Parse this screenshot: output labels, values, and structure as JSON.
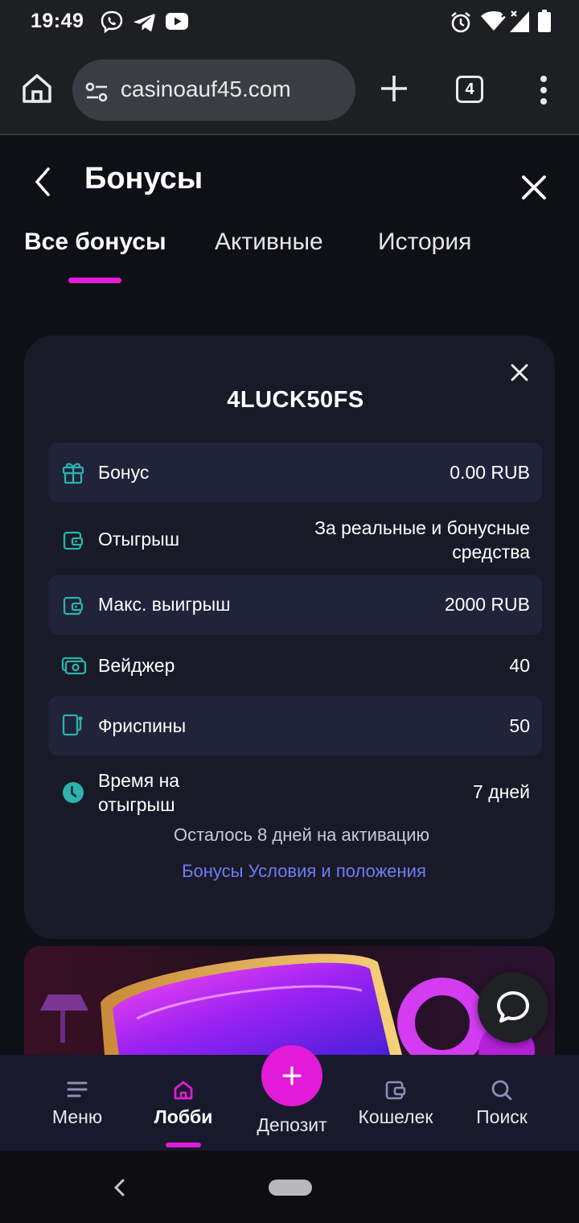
{
  "status_bar": {
    "time": "19:49",
    "left_icons": [
      "viber-icon",
      "telegram-icon",
      "youtube-icon"
    ],
    "right_icons": [
      "alarm-icon",
      "wifi-icon",
      "signal-icon",
      "battery-icon"
    ]
  },
  "browser": {
    "url": "casinoauf45.com",
    "tab_count": "4"
  },
  "header": {
    "title": "Бонусы"
  },
  "tabs": [
    {
      "label": "Все бонусы",
      "selected": true
    },
    {
      "label": "Активные",
      "selected": false
    },
    {
      "label": "История",
      "selected": false
    }
  ],
  "bonus_card": {
    "code": "4LUCK50FS",
    "rows": [
      {
        "icon": "gift-icon",
        "label": "Бонус",
        "value": "0.00 RUB"
      },
      {
        "icon": "wallet-icon",
        "label": "Отыгрыш",
        "value_line1": "За реальные и бонусные",
        "value_line2": "средства"
      },
      {
        "icon": "wallet-icon",
        "label": "Макс. выигрыш",
        "value": "2000 RUB"
      },
      {
        "icon": "cash-icon",
        "label": "Вейджер",
        "value": "40"
      },
      {
        "icon": "slot-machine-icon",
        "label": "Фриспины",
        "value": "50"
      },
      {
        "icon": "clock-icon",
        "label_line1": "Время на",
        "label_line2": "отыгрыш",
        "value": "7 дней"
      }
    ],
    "activation_note": "Осталось 8 дней на активацию",
    "terms_link": "Бонусы Условия и положения"
  },
  "bottom_nav": [
    {
      "label": "Меню",
      "icon": "menu-icon"
    },
    {
      "label": "Лобби",
      "icon": "home-icon",
      "selected": true
    },
    {
      "label": "Депозит",
      "icon": "plus-icon"
    },
    {
      "label": "Кошелек",
      "icon": "wallet-icon"
    },
    {
      "label": "Поиск",
      "icon": "search-icon"
    }
  ],
  "colors": {
    "accent": "#e21bd8",
    "icon_teal": "#2bb3ad",
    "link": "#6f7cf2",
    "background": "#0f0f17",
    "card": "#181a28",
    "row_shaded": "#20233a"
  }
}
